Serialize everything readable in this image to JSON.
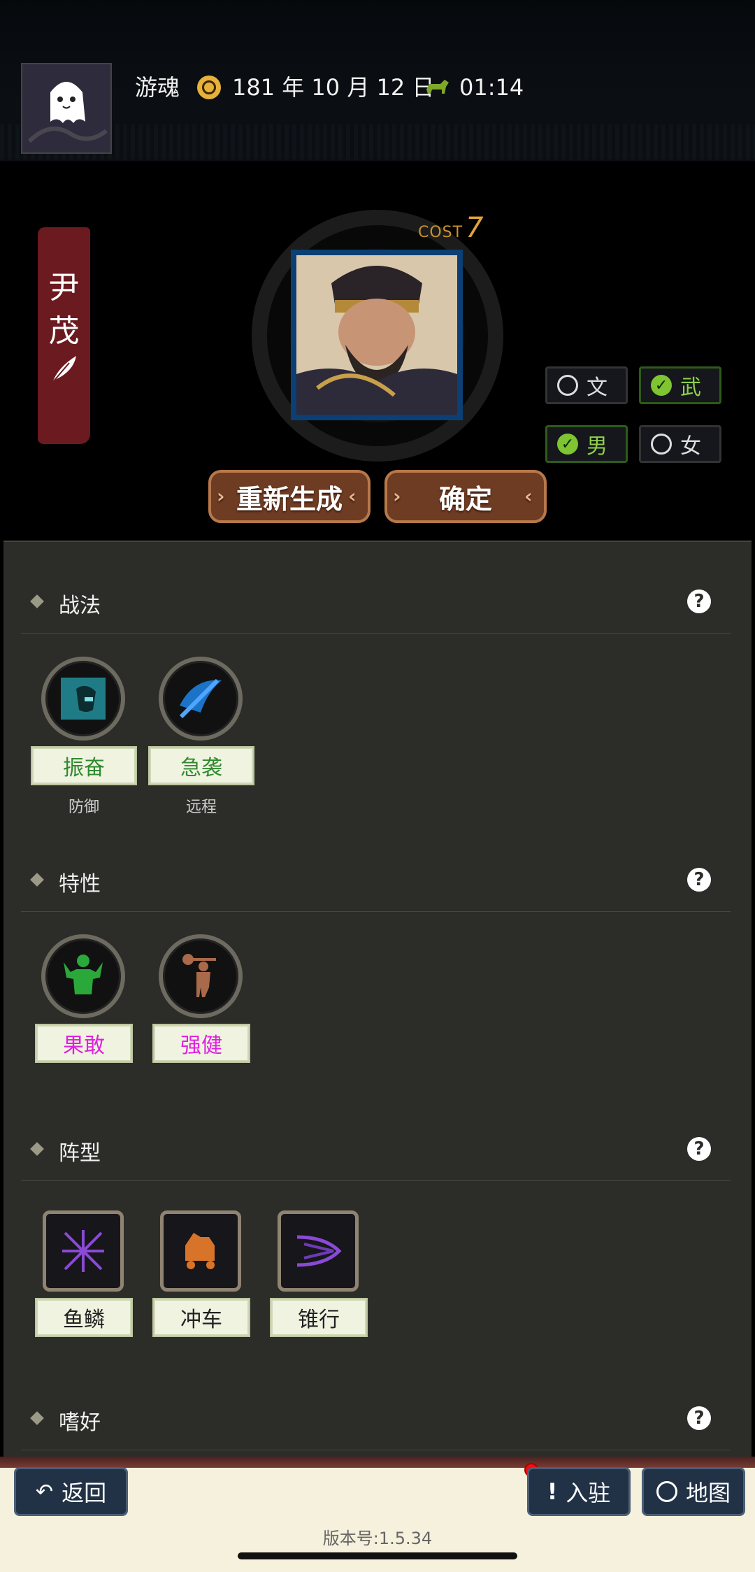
{
  "header": {
    "mode_label": "游魂",
    "date_text": "181 年 10 月 12 日",
    "time_text": "01:14",
    "icons": [
      "ghost-avatar-icon",
      "calendar-seal-icon",
      "horse-icon"
    ]
  },
  "character": {
    "name_chars": [
      "尹",
      "茂"
    ],
    "cost_label": "COST",
    "cost_value": "7",
    "emblem_icon": "feather-icon"
  },
  "toggles": {
    "civil": {
      "label": "文",
      "checked": false
    },
    "military": {
      "label": "武",
      "checked": true
    },
    "male": {
      "label": "男",
      "checked": true
    },
    "female": {
      "label": "女",
      "checked": false
    }
  },
  "actions": {
    "regenerate": "重新生成",
    "confirm": "确定"
  },
  "sections": {
    "tactics": {
      "title": "战法",
      "items": [
        {
          "name": "振奋",
          "type": "防御",
          "color": "#2f8a2f"
        },
        {
          "name": "急袭",
          "type": "远程",
          "color": "#2f8a2f"
        }
      ]
    },
    "traits": {
      "title": "特性",
      "items": [
        {
          "name": "果敢",
          "color": "#e020e0"
        },
        {
          "name": "强健",
          "color": "#e020e0"
        }
      ]
    },
    "formations": {
      "title": "阵型",
      "items": [
        {
          "name": "鱼鳞",
          "color": "#222222"
        },
        {
          "name": "冲车",
          "color": "#222222"
        },
        {
          "name": "锥行",
          "color": "#222222"
        }
      ]
    },
    "hobbies": {
      "title": "嗜好"
    }
  },
  "bottom_nav": {
    "back": "返回",
    "station": "入驻",
    "map": "地图",
    "version": "版本号:1.5.34"
  },
  "colors": {
    "accent_green": "#7fc431",
    "button_brown": "#6e3b23",
    "panel_bg": "#2c2d29"
  }
}
